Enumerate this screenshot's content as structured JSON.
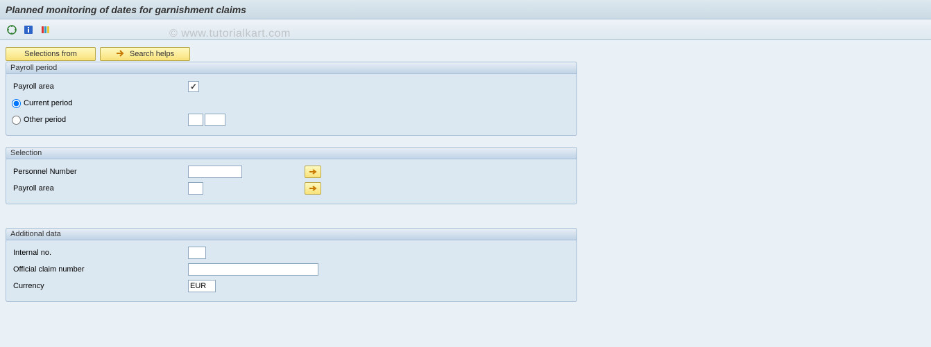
{
  "header": {
    "title": "Planned monitoring of dates for garnishment claims"
  },
  "watermark": "© www.tutorialkart.com",
  "buttons": {
    "selections_from": "Selections from",
    "search_helps": "Search helps"
  },
  "groups": {
    "payroll_period": {
      "title": "Payroll period",
      "payroll_area_label": "Payroll area",
      "payroll_area_checked": "✓",
      "current_period_label": "Current period",
      "other_period_label": "Other period",
      "other_val1": "",
      "other_val2": ""
    },
    "selection": {
      "title": "Selection",
      "personnel_number_label": "Personnel Number",
      "personnel_number_value": "",
      "payroll_area_label": "Payroll area",
      "payroll_area_value": ""
    },
    "additional_data": {
      "title": "Additional data",
      "internal_no_label": "Internal no.",
      "internal_no_value": "",
      "official_claim_label": "Official claim number",
      "official_claim_value": "",
      "currency_label": "Currency",
      "currency_value": "EUR"
    }
  }
}
